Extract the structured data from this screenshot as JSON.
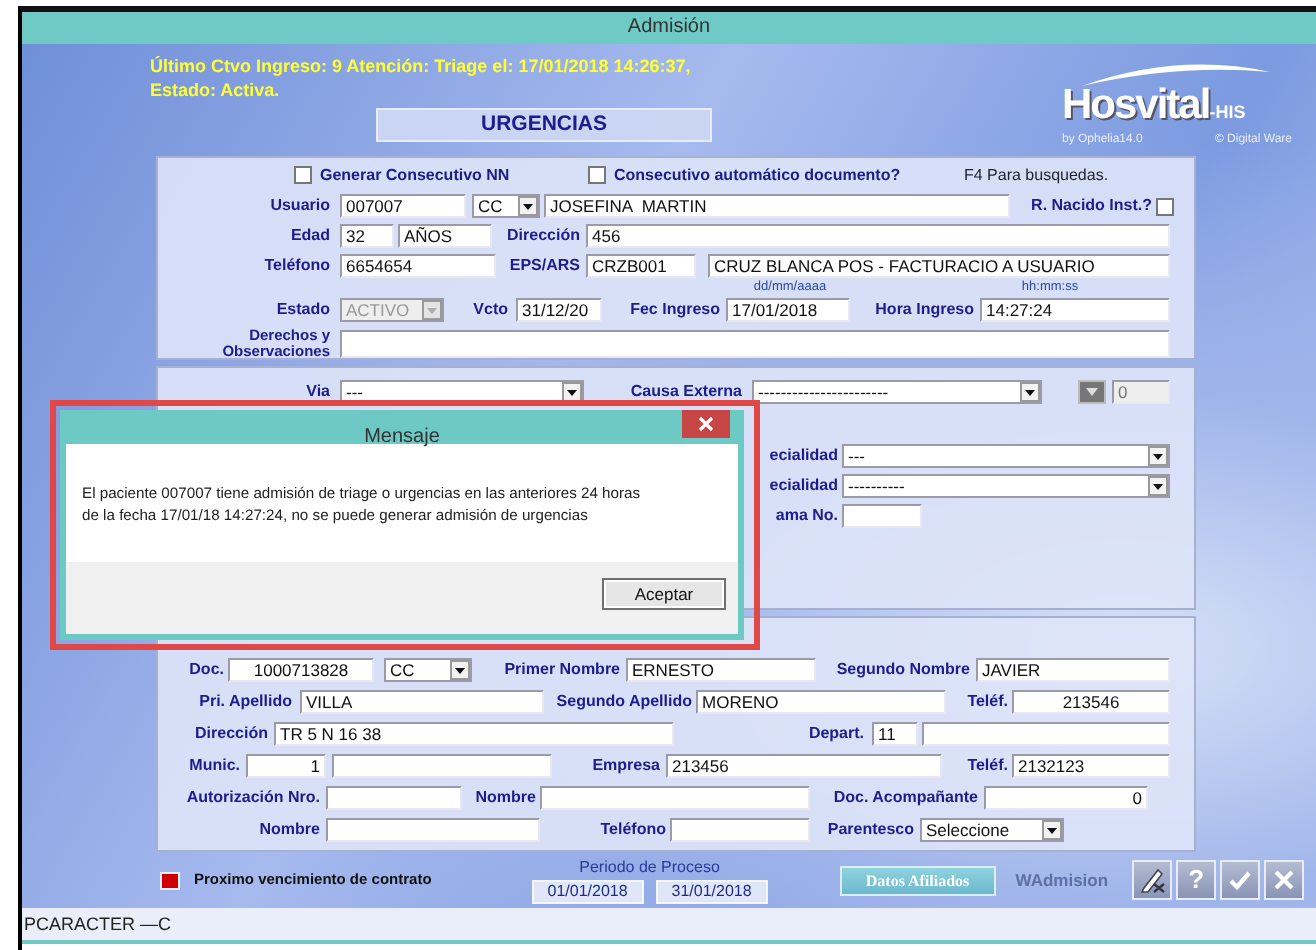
{
  "window": {
    "title": "Admisión"
  },
  "header": {
    "notice": "Último Ctvo Ingreso: 9 Atención: Triage el: 17/01/2018 14:26:37, Estado: Activa.",
    "mode": "URGENCIAS",
    "logo": {
      "name": "Hosvital",
      "suffix": "-HIS",
      "byline": "by Ophelia14.0",
      "vendor": "© Digital Ware"
    }
  },
  "panels": [
    {
      "rows": [
        {
          "items": [
            {
              "kind": "check",
              "label": "Generar Consecutivo NN",
              "checked": false
            },
            {
              "kind": "check",
              "label": "Consecutivo automático documento?",
              "checked": false
            },
            {
              "kind": "hint",
              "text": "F4 Para busquedas."
            }
          ]
        },
        {
          "items": [
            {
              "kind": "label",
              "text": "Usuario"
            },
            {
              "kind": "field",
              "value": "007007",
              "disabled": false
            },
            {
              "kind": "select",
              "value": "CC",
              "disabled": false
            },
            {
              "kind": "field",
              "value": "JOSEFINA  MARTIN",
              "disabled": false
            },
            {
              "kind": "label",
              "text": "R. Nacido Inst.?"
            },
            {
              "kind": "check",
              "checked": false
            }
          ]
        },
        {
          "items": [
            {
              "kind": "label",
              "text": "Edad"
            },
            {
              "kind": "field",
              "value": "32",
              "disabled": false
            },
            {
              "kind": "field",
              "value": "AÑOS",
              "disabled": false
            },
            {
              "kind": "label",
              "text": "Dirección"
            },
            {
              "kind": "field",
              "value": "456",
              "disabled": false
            }
          ]
        },
        {
          "items": [
            {
              "kind": "label",
              "text": "Teléfono"
            },
            {
              "kind": "field",
              "value": "6654654",
              "disabled": false
            },
            {
              "kind": "label",
              "text": "EPS/ARS"
            },
            {
              "kind": "field",
              "value": "CRZB001",
              "disabled": false
            },
            {
              "kind": "field",
              "value": "CRUZ BLANCA POS - FACTURACIO A USUARIO",
              "disabled": false
            }
          ]
        },
        {
          "items": [
            {
              "kind": "format",
              "text": "dd/mm/aaaa"
            },
            {
              "kind": "format",
              "text": "hh:mm:ss"
            }
          ]
        },
        {
          "items": [
            {
              "kind": "label",
              "text": "Estado"
            },
            {
              "kind": "select",
              "value": "ACTIVO",
              "disabled": true
            },
            {
              "kind": "label",
              "text": "Vcto"
            },
            {
              "kind": "field",
              "value": "31/12/20",
              "disabled": false
            },
            {
              "kind": "label",
              "text": "Fec Ingreso"
            },
            {
              "kind": "field",
              "value": "17/01/2018",
              "disabled": false
            },
            {
              "kind": "label",
              "text": "Hora Ingreso"
            },
            {
              "kind": "field",
              "value": "14:27:24",
              "disabled": false
            }
          ]
        },
        {
          "items": [
            {
              "kind": "label",
              "text": "Derechos y Observaciones"
            },
            {
              "kind": "field",
              "disabled": false
            }
          ]
        }
      ]
    },
    {
      "rows": [
        {
          "items": [
            {
              "kind": "label",
              "text": "Via"
            },
            {
              "kind": "select",
              "value": "---",
              "disabled": false
            },
            {
              "kind": "label",
              "text": "Causa Externa"
            },
            {
              "kind": "select",
              "value": "-----------------------",
              "disabled": false
            },
            {
              "kind": "button",
              "disabled": true
            },
            {
              "kind": "field",
              "value": "0",
              "disabled": true
            }
          ]
        },
        {
          "items": [
            {
              "kind": "label",
              "text": "ecialidad"
            },
            {
              "kind": "select",
              "value": "---",
              "disabled": false
            }
          ]
        },
        {
          "items": [
            {
              "kind": "label",
              "text": "ecialidad"
            },
            {
              "kind": "select",
              "value": "----------",
              "disabled": false
            }
          ]
        },
        {
          "items": [
            {
              "kind": "label",
              "text": "ama No."
            },
            {
              "kind": "field",
              "disabled": false
            }
          ]
        }
      ]
    },
    {
      "rows": [
        {
          "items": [
            {
              "kind": "label",
              "text": "Doc."
            },
            {
              "kind": "field",
              "value": "1000713828",
              "disabled": false
            },
            {
              "kind": "select",
              "value": "CC",
              "disabled": false
            },
            {
              "kind": "label",
              "text": "Primer Nombre"
            },
            {
              "kind": "field",
              "value": "ERNESTO",
              "disabled": false
            },
            {
              "kind": "label",
              "text": "Segundo Nombre"
            },
            {
              "kind": "field",
              "value": "JAVIER",
              "disabled": false
            }
          ]
        },
        {
          "items": [
            {
              "kind": "label",
              "text": "Pri. Apellido"
            },
            {
              "kind": "field",
              "value": "VILLA",
              "disabled": false
            },
            {
              "kind": "label",
              "text": "Segundo Apellido"
            },
            {
              "kind": "field",
              "value": "MORENO",
              "disabled": false
            },
            {
              "kind": "label",
              "text": "Teléf."
            },
            {
              "kind": "field",
              "value": "213546",
              "disabled": false
            }
          ]
        },
        {
          "items": [
            {
              "kind": "label",
              "text": "Dirección"
            },
            {
              "kind": "field",
              "value": "TR 5 N 16 38",
              "disabled": false
            },
            {
              "kind": "label",
              "text": "Depart."
            },
            {
              "kind": "field",
              "value": "11",
              "disabled": false
            },
            {
              "kind": "field",
              "disabled": false
            }
          ]
        },
        {
          "items": [
            {
              "kind": "label",
              "text": "Munic."
            },
            {
              "kind": "field",
              "value": "1",
              "disabled": false
            },
            {
              "kind": "field",
              "disabled": false
            },
            {
              "kind": "label",
              "text": "Empresa"
            },
            {
              "kind": "field",
              "value": "213456",
              "disabled": false
            },
            {
              "kind": "label",
              "text": "Teléf."
            },
            {
              "kind": "field",
              "value": "2132123",
              "disabled": false
            }
          ]
        },
        {
          "items": [
            {
              "kind": "label",
              "text": "Autorización Nro."
            },
            {
              "kind": "field",
              "disabled": false
            },
            {
              "kind": "label",
              "text": "Nombre"
            },
            {
              "kind": "field",
              "disabled": false
            },
            {
              "kind": "label",
              "text": "Doc. Acompañante"
            },
            {
              "kind": "field",
              "value": "0",
              "disabled": false
            }
          ]
        },
        {
          "items": [
            {
              "kind": "label",
              "text": "Nombre"
            },
            {
              "kind": "field",
              "disabled": false
            },
            {
              "kind": "label",
              "text": "Teléfono"
            },
            {
              "kind": "field",
              "disabled": false
            },
            {
              "kind": "label",
              "text": "Parentesco"
            },
            {
              "kind": "select",
              "value": "Seleccione",
              "disabled": false
            }
          ]
        }
      ]
    }
  ],
  "dialog": {
    "title": "Mensaje",
    "lines": [
      "El paciente 007007 tiene admisión de triage o urgencias en las anteriores 24 horas",
      "de la fecha 17/01/18 14:27:24, no se puede generar admisión de urgencias"
    ],
    "button": "Aceptar",
    "highlighted": true
  },
  "footer": {
    "legend": {
      "color": "#cc0000",
      "text": "Proximo vencimiento de contrato"
    },
    "period": {
      "label": "Periodo de Proceso",
      "from": "01/01/2018",
      "to": "31/01/2018"
    },
    "affiliates_button": "Datos Afiliados",
    "form_name": "WAdmision",
    "tools": [
      {
        "kind": "edit"
      },
      {
        "kind": "help",
        "text": "?"
      },
      {
        "kind": "accept"
      },
      {
        "kind": "cancel"
      }
    ]
  },
  "status_bar": {
    "text": "PCARACTER —C"
  }
}
